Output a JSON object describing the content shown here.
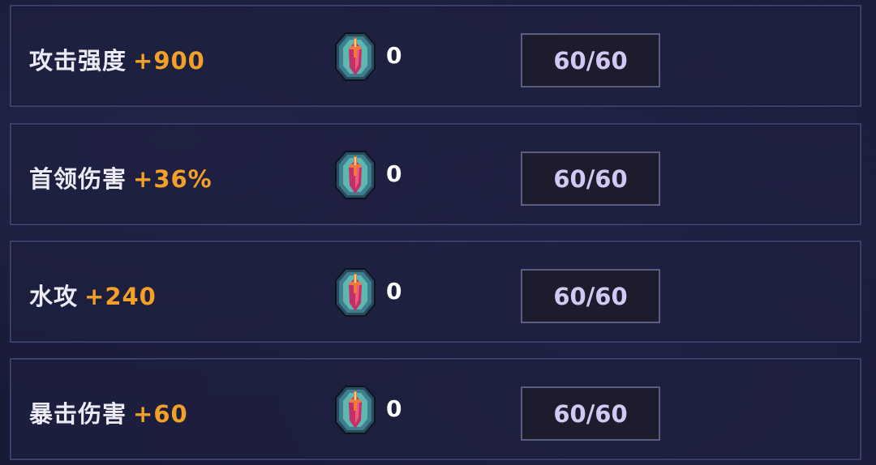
{
  "rows": [
    {
      "name": "攻击强度",
      "bonus": "+900",
      "count": "0",
      "level": "60/60"
    },
    {
      "name": "首领伤害",
      "bonus": "+36%",
      "count": "0",
      "level": "60/60"
    },
    {
      "name": "水攻",
      "bonus": "+240",
      "count": "0",
      "level": "60/60"
    },
    {
      "name": "暴击伤害",
      "bonus": "+60",
      "count": "0",
      "level": "60/60"
    }
  ],
  "colors": {
    "background": "#181a36",
    "panel_border": "#3b3f6c",
    "stat_name": "#ecebf4",
    "bonus": "#f3a029",
    "level_text": "#d3c8f4"
  },
  "icons": {
    "gem": "crystal-gem-icon"
  }
}
